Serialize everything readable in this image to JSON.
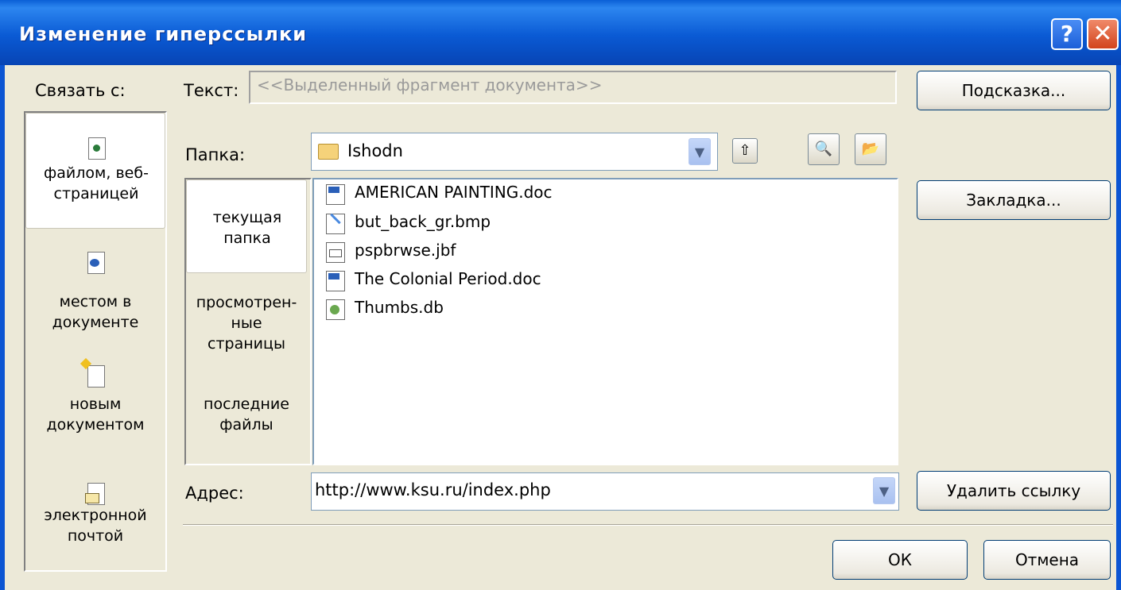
{
  "window": {
    "title": "Изменение гиперссылки",
    "help_label": "?",
    "close_label": "✕"
  },
  "link_with": {
    "label": "Связать с:",
    "items": [
      {
        "label": "файлом, веб-\nстраницей",
        "icon": "web-page-file-icon",
        "selected": true
      },
      {
        "label": "местом в\nдокументе",
        "icon": "place-in-document-icon",
        "selected": false
      },
      {
        "label": "новым\nдокументом",
        "icon": "new-document-icon",
        "selected": false
      },
      {
        "label": "электронной\nпочтой",
        "icon": "email-icon",
        "selected": false
      }
    ]
  },
  "text_field": {
    "label": "Текст:",
    "value": "<<Выделенный фрагмент документа>>"
  },
  "folder": {
    "label": "Папка:",
    "value": "Ishodn"
  },
  "look_in": {
    "items": [
      {
        "label": "текущая\nпапка",
        "selected": true
      },
      {
        "label": "просмотрен-\nные\nстраницы",
        "selected": false
      },
      {
        "label": "последние\nфайлы",
        "selected": false
      }
    ]
  },
  "files": [
    {
      "name": "AMERICAN PAINTING.doc",
      "icon": "word-document-icon"
    },
    {
      "name": "but_back_gr.bmp",
      "icon": "bitmap-image-icon"
    },
    {
      "name": "pspbrwse.jbf",
      "icon": "generic-file-icon"
    },
    {
      "name": "The Colonial Period.doc",
      "icon": "word-document-icon"
    },
    {
      "name": "Thumbs.db",
      "icon": "database-file-icon"
    }
  ],
  "address": {
    "label": "Адрес:",
    "value": "http://www.ksu.ru/index.php"
  },
  "buttons": {
    "screentip": "Подсказка...",
    "bookmark": "Закладка...",
    "remove_link": "Удалить ссылку",
    "ok": "ОК",
    "cancel": "Отмена"
  },
  "colors": {
    "titlebar": "#0a5ad4",
    "dialog_bg": "#ece9d8",
    "button_border": "#003c74"
  }
}
